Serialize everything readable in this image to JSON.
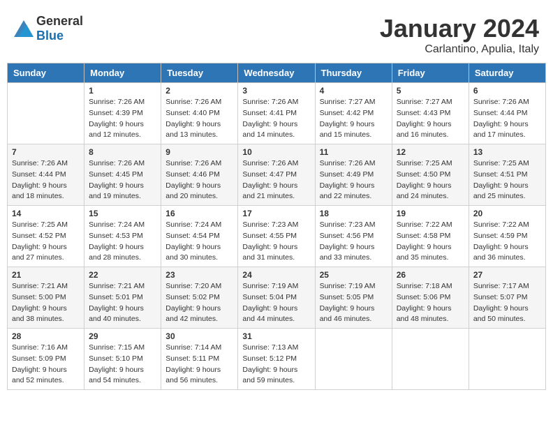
{
  "header": {
    "logo_general": "General",
    "logo_blue": "Blue",
    "title": "January 2024",
    "subtitle": "Carlantino, Apulia, Italy"
  },
  "days_of_week": [
    "Sunday",
    "Monday",
    "Tuesday",
    "Wednesday",
    "Thursday",
    "Friday",
    "Saturday"
  ],
  "weeks": [
    [
      {
        "day": null,
        "sunrise": null,
        "sunset": null,
        "daylight": null
      },
      {
        "day": "1",
        "sunrise": "Sunrise: 7:26 AM",
        "sunset": "Sunset: 4:39 PM",
        "daylight": "Daylight: 9 hours and 12 minutes."
      },
      {
        "day": "2",
        "sunrise": "Sunrise: 7:26 AM",
        "sunset": "Sunset: 4:40 PM",
        "daylight": "Daylight: 9 hours and 13 minutes."
      },
      {
        "day": "3",
        "sunrise": "Sunrise: 7:26 AM",
        "sunset": "Sunset: 4:41 PM",
        "daylight": "Daylight: 9 hours and 14 minutes."
      },
      {
        "day": "4",
        "sunrise": "Sunrise: 7:27 AM",
        "sunset": "Sunset: 4:42 PM",
        "daylight": "Daylight: 9 hours and 15 minutes."
      },
      {
        "day": "5",
        "sunrise": "Sunrise: 7:27 AM",
        "sunset": "Sunset: 4:43 PM",
        "daylight": "Daylight: 9 hours and 16 minutes."
      },
      {
        "day": "6",
        "sunrise": "Sunrise: 7:26 AM",
        "sunset": "Sunset: 4:44 PM",
        "daylight": "Daylight: 9 hours and 17 minutes."
      }
    ],
    [
      {
        "day": "7",
        "sunrise": "Sunrise: 7:26 AM",
        "sunset": "Sunset: 4:44 PM",
        "daylight": "Daylight: 9 hours and 18 minutes."
      },
      {
        "day": "8",
        "sunrise": "Sunrise: 7:26 AM",
        "sunset": "Sunset: 4:45 PM",
        "daylight": "Daylight: 9 hours and 19 minutes."
      },
      {
        "day": "9",
        "sunrise": "Sunrise: 7:26 AM",
        "sunset": "Sunset: 4:46 PM",
        "daylight": "Daylight: 9 hours and 20 minutes."
      },
      {
        "day": "10",
        "sunrise": "Sunrise: 7:26 AM",
        "sunset": "Sunset: 4:47 PM",
        "daylight": "Daylight: 9 hours and 21 minutes."
      },
      {
        "day": "11",
        "sunrise": "Sunrise: 7:26 AM",
        "sunset": "Sunset: 4:49 PM",
        "daylight": "Daylight: 9 hours and 22 minutes."
      },
      {
        "day": "12",
        "sunrise": "Sunrise: 7:25 AM",
        "sunset": "Sunset: 4:50 PM",
        "daylight": "Daylight: 9 hours and 24 minutes."
      },
      {
        "day": "13",
        "sunrise": "Sunrise: 7:25 AM",
        "sunset": "Sunset: 4:51 PM",
        "daylight": "Daylight: 9 hours and 25 minutes."
      }
    ],
    [
      {
        "day": "14",
        "sunrise": "Sunrise: 7:25 AM",
        "sunset": "Sunset: 4:52 PM",
        "daylight": "Daylight: 9 hours and 27 minutes."
      },
      {
        "day": "15",
        "sunrise": "Sunrise: 7:24 AM",
        "sunset": "Sunset: 4:53 PM",
        "daylight": "Daylight: 9 hours and 28 minutes."
      },
      {
        "day": "16",
        "sunrise": "Sunrise: 7:24 AM",
        "sunset": "Sunset: 4:54 PM",
        "daylight": "Daylight: 9 hours and 30 minutes."
      },
      {
        "day": "17",
        "sunrise": "Sunrise: 7:23 AM",
        "sunset": "Sunset: 4:55 PM",
        "daylight": "Daylight: 9 hours and 31 minutes."
      },
      {
        "day": "18",
        "sunrise": "Sunrise: 7:23 AM",
        "sunset": "Sunset: 4:56 PM",
        "daylight": "Daylight: 9 hours and 33 minutes."
      },
      {
        "day": "19",
        "sunrise": "Sunrise: 7:22 AM",
        "sunset": "Sunset: 4:58 PM",
        "daylight": "Daylight: 9 hours and 35 minutes."
      },
      {
        "day": "20",
        "sunrise": "Sunrise: 7:22 AM",
        "sunset": "Sunset: 4:59 PM",
        "daylight": "Daylight: 9 hours and 36 minutes."
      }
    ],
    [
      {
        "day": "21",
        "sunrise": "Sunrise: 7:21 AM",
        "sunset": "Sunset: 5:00 PM",
        "daylight": "Daylight: 9 hours and 38 minutes."
      },
      {
        "day": "22",
        "sunrise": "Sunrise: 7:21 AM",
        "sunset": "Sunset: 5:01 PM",
        "daylight": "Daylight: 9 hours and 40 minutes."
      },
      {
        "day": "23",
        "sunrise": "Sunrise: 7:20 AM",
        "sunset": "Sunset: 5:02 PM",
        "daylight": "Daylight: 9 hours and 42 minutes."
      },
      {
        "day": "24",
        "sunrise": "Sunrise: 7:19 AM",
        "sunset": "Sunset: 5:04 PM",
        "daylight": "Daylight: 9 hours and 44 minutes."
      },
      {
        "day": "25",
        "sunrise": "Sunrise: 7:19 AM",
        "sunset": "Sunset: 5:05 PM",
        "daylight": "Daylight: 9 hours and 46 minutes."
      },
      {
        "day": "26",
        "sunrise": "Sunrise: 7:18 AM",
        "sunset": "Sunset: 5:06 PM",
        "daylight": "Daylight: 9 hours and 48 minutes."
      },
      {
        "day": "27",
        "sunrise": "Sunrise: 7:17 AM",
        "sunset": "Sunset: 5:07 PM",
        "daylight": "Daylight: 9 hours and 50 minutes."
      }
    ],
    [
      {
        "day": "28",
        "sunrise": "Sunrise: 7:16 AM",
        "sunset": "Sunset: 5:09 PM",
        "daylight": "Daylight: 9 hours and 52 minutes."
      },
      {
        "day": "29",
        "sunrise": "Sunrise: 7:15 AM",
        "sunset": "Sunset: 5:10 PM",
        "daylight": "Daylight: 9 hours and 54 minutes."
      },
      {
        "day": "30",
        "sunrise": "Sunrise: 7:14 AM",
        "sunset": "Sunset: 5:11 PM",
        "daylight": "Daylight: 9 hours and 56 minutes."
      },
      {
        "day": "31",
        "sunrise": "Sunrise: 7:13 AM",
        "sunset": "Sunset: 5:12 PM",
        "daylight": "Daylight: 9 hours and 59 minutes."
      },
      {
        "day": null,
        "sunrise": null,
        "sunset": null,
        "daylight": null
      },
      {
        "day": null,
        "sunrise": null,
        "sunset": null,
        "daylight": null
      },
      {
        "day": null,
        "sunrise": null,
        "sunset": null,
        "daylight": null
      }
    ]
  ]
}
